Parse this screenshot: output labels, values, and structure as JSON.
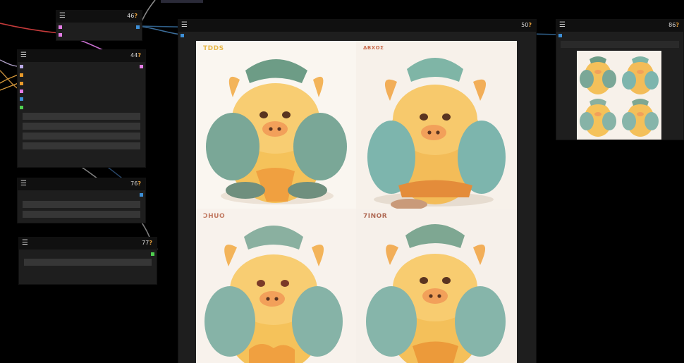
{
  "nodes": [
    {
      "id_label": "46",
      "badge": "?"
    },
    {
      "id_label": "44",
      "badge": "?"
    },
    {
      "id_label": "76",
      "badge": "?"
    },
    {
      "id_label": "77",
      "badge": "?"
    },
    {
      "id_label": "50",
      "badge": "?"
    },
    {
      "id_label": "86",
      "badge": "?"
    }
  ],
  "menu_glyph": "☰",
  "preview": {
    "watermarks": [
      "TDDS",
      "ΔΒΧΟΣ",
      "ƆHUO",
      "7INOR"
    ]
  },
  "colors": {
    "canvas": "#000000",
    "node_body": "#1e1e1e",
    "node_header": "#101010",
    "widget": "#363636",
    "slot_pink": "#e47de6",
    "slot_blue": "#3d8fd7",
    "slot_orange": "#e89a2a",
    "slot_green": "#4fd04f",
    "badge": "#e9a13b"
  }
}
